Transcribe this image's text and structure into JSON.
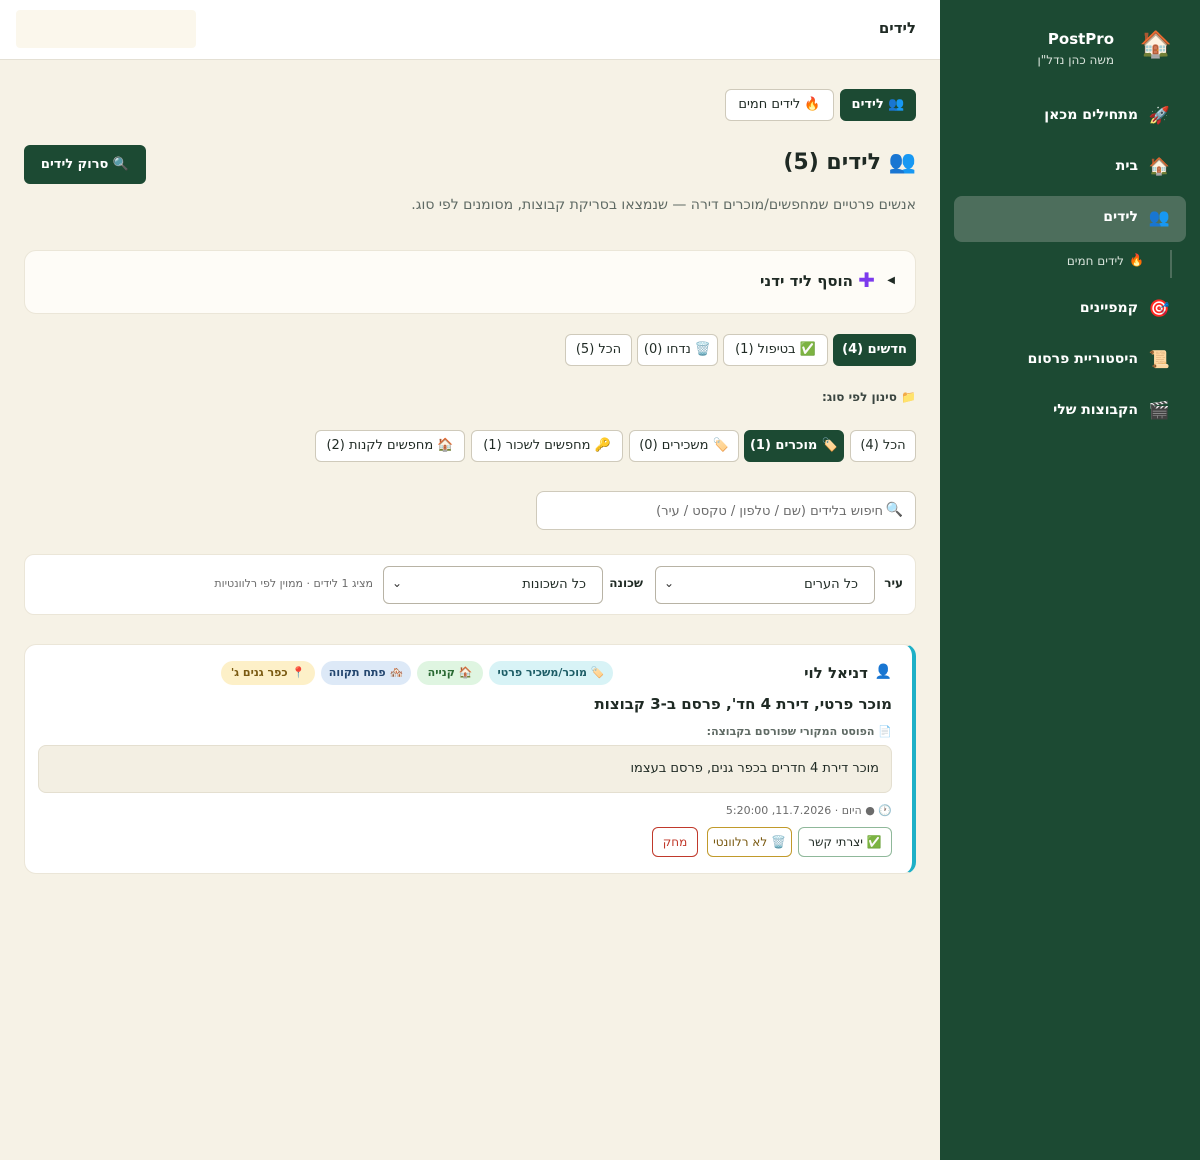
{
  "sidebar": {
    "brand": {
      "icon": "🏠",
      "name": "PostPro",
      "subtitle": "משה כהן נדל\"ן"
    },
    "items": [
      {
        "icon": "🚀",
        "label": "מתחילים מכאן"
      },
      {
        "icon": "🏠",
        "label": "בית"
      },
      {
        "icon": "👥",
        "label": "לידים"
      },
      {
        "icon": "🎯",
        "label": "קמפיינים"
      },
      {
        "icon": "📜",
        "label": "היסטוריית פרסום"
      },
      {
        "icon": "🎬",
        "label": "הקבוצות שלי"
      }
    ],
    "sub_item": {
      "icon": "🔥",
      "label": "לידים חמים"
    }
  },
  "topbar": {
    "title": "לידים"
  },
  "tabs": {
    "leads": "👥 לידים",
    "hot_leads": "🔥 לידים חמים"
  },
  "page": {
    "title": "👥 לידים (5)",
    "scan_button": "🔍 סרוק לידים",
    "subtitle": "אנשים פרטיים שמחפשים/מוכרים דירה — שנמצאו בסריקת קבוצות, מסומנים לפי סוג."
  },
  "add_manual": {
    "arrow": "◀",
    "plus": "✚",
    "label": "הוסף ליד ידני"
  },
  "status_filters": [
    "חדשים (4)",
    "✅ בטיפול (1)",
    "🗑️ נדחו (0)",
    "הכל (5)"
  ],
  "type_filter": {
    "label": "📁 סינון לפי סוג:",
    "options": [
      "הכל (4)",
      "🏷️ מוכרים (1)",
      "🏷️ משכירים (0)",
      "🔑 מחפשים לשכור (1)",
      "🏠 מחפשים לקנות (2)"
    ]
  },
  "search": {
    "icon": "🔍",
    "placeholder": "חיפוש בלידים (שם / טלפון / טקסט / עיר)"
  },
  "filters": {
    "city_label": "עיר",
    "city_value": "כל הערים",
    "neighborhood_label": "שכונה",
    "neighborhood_value": "כל השכונות",
    "note": "מציג 1 לידים · ממוין לפי רלוונטיות"
  },
  "lead": {
    "icon": "👤",
    "name": "דניאל לוי",
    "chips": [
      "🏷️ מוכר/משכיר פרטי",
      "🏠 קנייה",
      "🏘️ פתח תקווה",
      "📍 כפר גנים ג'"
    ],
    "headline": "מוכר פרטי, דירת 4 חד', פרסם ב-3 קבוצות",
    "original_label": "📄 הפוסט המקורי שפורסם בקבוצה:",
    "original_post": "מוכר דירת 4 חדרים בכפר גנים, פרסם בעצמו",
    "time": "🕐 ● היום · 11.7.2026, 5:20:00",
    "actions": {
      "contacted": "✅ יצרתי קשר",
      "irrelevant": "🗑️ לא רלוונטי",
      "delete": "מחק"
    }
  },
  "colors": {
    "sidebar_bg": "#1c4a33",
    "page_bg": "#f6f2e6",
    "accent_cyan": "#1eb0c7",
    "delete_red": "#c0392b",
    "irrelevant_gold": "#c19a2b"
  }
}
